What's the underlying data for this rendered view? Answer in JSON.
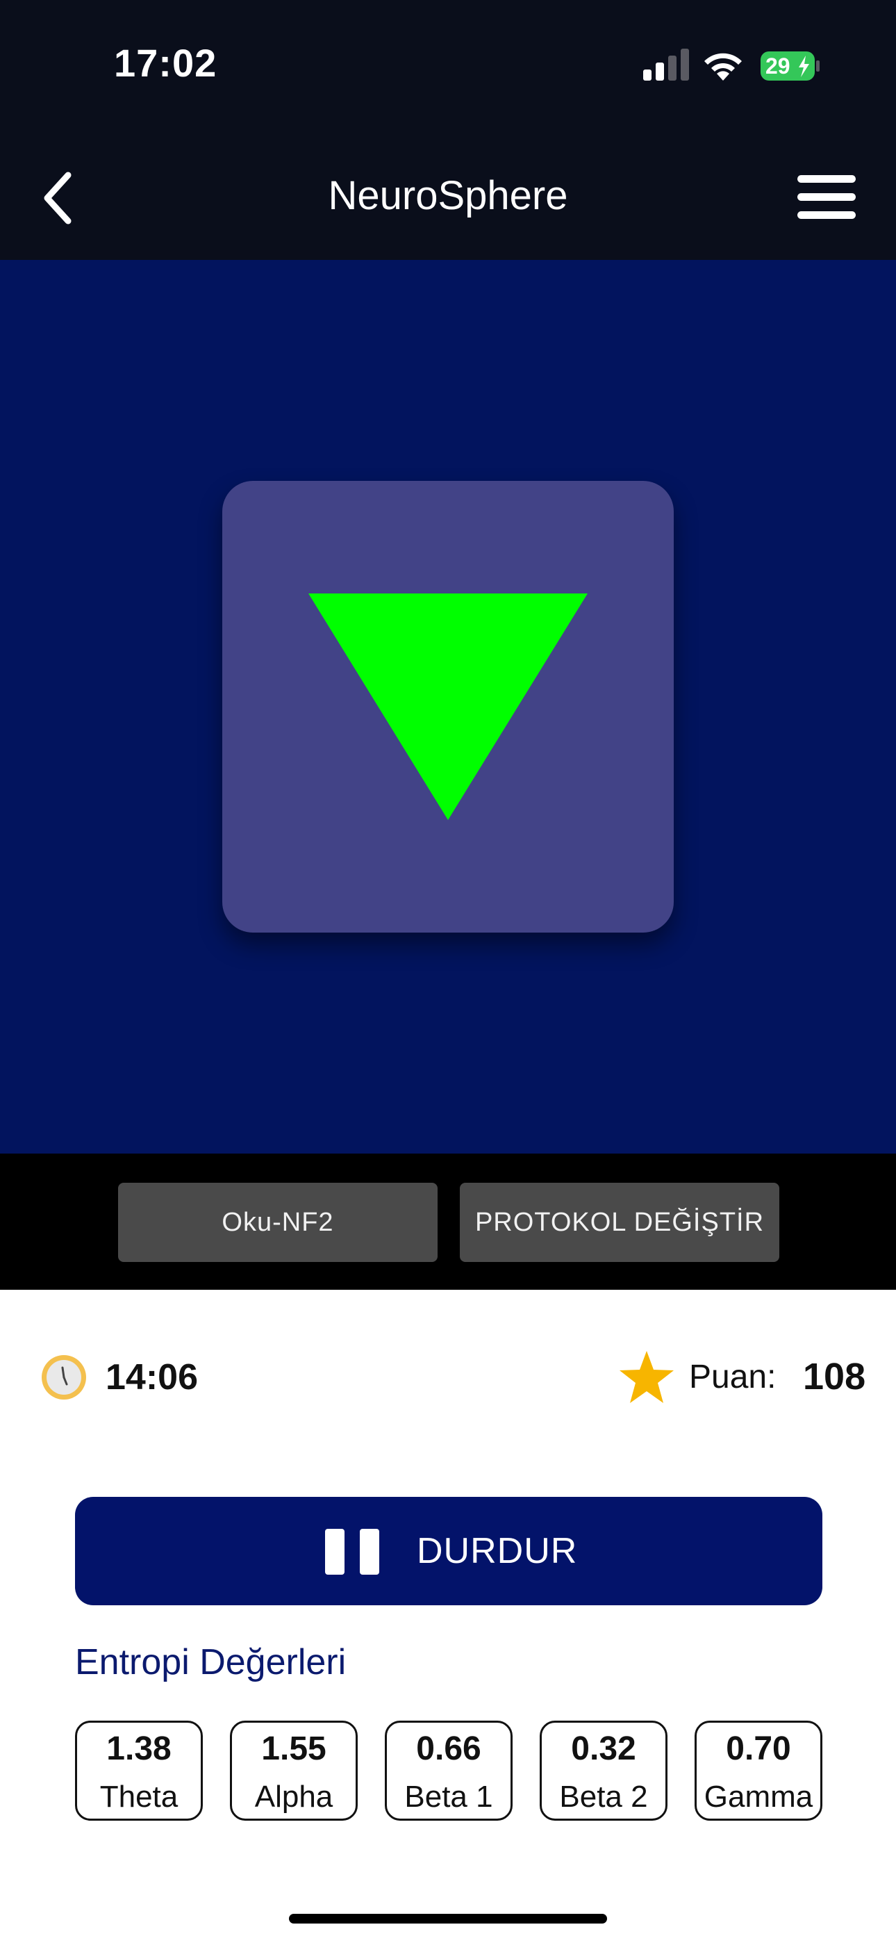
{
  "status_bar": {
    "time": "17:02",
    "battery_level": "29",
    "signal_icon": "cellular-signal-icon",
    "wifi_icon": "wifi-icon",
    "battery_icon": "battery-charging-icon"
  },
  "nav": {
    "title": "NeuroSphere",
    "back_icon": "chevron-left-icon",
    "menu_icon": "hamburger-menu-icon"
  },
  "stage": {
    "background_color": "#02145e",
    "tile_color": "#424387",
    "arrow_color": "#00ff00",
    "arrow_icon": "triangle-down-icon"
  },
  "controls": {
    "read_button": "Oku-NF2",
    "change_protocol_button": "PROTOKOL DEĞİŞTİR"
  },
  "info": {
    "clock_icon": "clock-icon",
    "timer": "14:06",
    "star_icon": "star-icon",
    "score_label": "Puan:",
    "score_value": "108"
  },
  "stop": {
    "label": "DURDUR",
    "icon": "pause-icon"
  },
  "entropy": {
    "title": "Entropi Değerleri",
    "bands": [
      {
        "value": "1.38",
        "label": "Theta"
      },
      {
        "value": "1.55",
        "label": "Alpha"
      },
      {
        "value": "0.66",
        "label": "Beta 1"
      },
      {
        "value": "0.32",
        "label": "Beta 2"
      },
      {
        "value": "0.70",
        "label": "Gamma"
      }
    ]
  },
  "colors": {
    "primary": "#03136a",
    "status_green": "#34c759",
    "star_gold": "#f7b500"
  }
}
